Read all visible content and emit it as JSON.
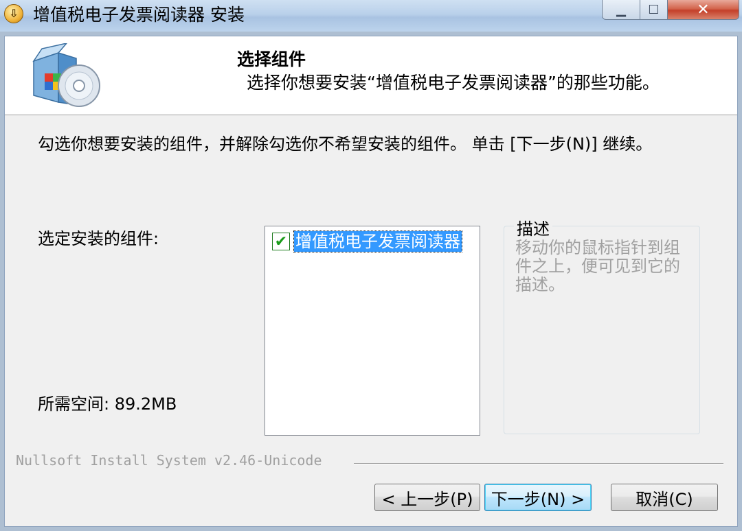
{
  "window": {
    "title": "增值税电子发票阅读器 安装",
    "min_symbol": "▁",
    "max_symbol": "☐",
    "close_symbol": "✕"
  },
  "header": {
    "title": "选择组件",
    "subtitle": "选择你想要安装“增值税电子发票阅读器”的那些功能。"
  },
  "intro": "勾选你想要安装的组件，并解除勾选你不希望安装的组件。 单击 [下一步(N)] 继续。",
  "select_label": "选定安装的组件:",
  "space_label": "所需空间: 89.2MB",
  "components": [
    {
      "label": "增值税电子发票阅读器",
      "checked": true,
      "check_symbol": "✔"
    }
  ],
  "description": {
    "legend": "描述",
    "text": "移动你的鼠标指针到组件之上，便可见到它的描述。"
  },
  "branding": "Nullsoft Install System v2.46-Unicode",
  "buttons": {
    "back": "< 上一步(P)",
    "next": "下一步(N) >",
    "cancel": "取消(C)"
  },
  "colors": {
    "selection": "#3399ff",
    "checkmark": "#1b9c1b",
    "dialog_bg": "#f0f0f0"
  }
}
